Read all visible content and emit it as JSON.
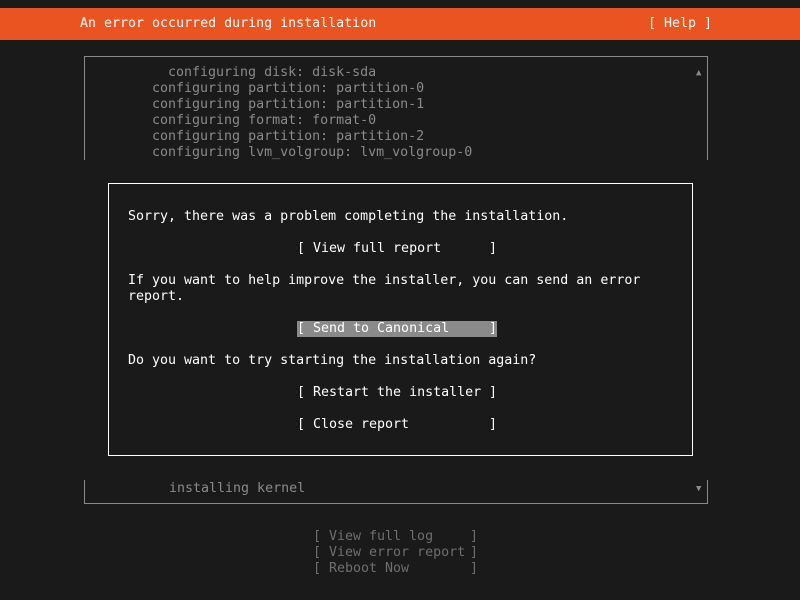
{
  "header": {
    "title": "An error occurred during installation",
    "help_label": "[ Help ]"
  },
  "log": {
    "lines": [
      "configuring disk: disk-sda",
      "configuring partition: partition-0",
      "configuring partition: partition-1",
      "configuring format: format-0",
      "configuring partition: partition-2",
      "configuring lvm_volgroup: lvm_volgroup-0"
    ],
    "scroll_up_glyph": "▲",
    "scroll_down_glyph": "▼",
    "status_line": "installing kernel"
  },
  "dialog": {
    "message1": "Sorry, there was a problem completing the installation.",
    "message2": "If you want to help improve the installer, you can send an error\nreport.",
    "message3": "Do you want to try starting the installation again?",
    "bracket_left": "[",
    "bracket_right": "]",
    "view_full_report": "View full report",
    "send_to_canonical": "Send to Canonical",
    "restart_installer": "Restart the installer",
    "close_report": "Close report"
  },
  "bottom": {
    "bracket_left": "[",
    "bracket_right": "]",
    "view_full_log": "View full log",
    "view_error_report": "View error report",
    "reboot_now": "Reboot Now"
  },
  "colors": {
    "accent": "#e95420",
    "background": "#1a1a1a",
    "text": "#ffffff",
    "muted": "#8a8a8a",
    "disabled": "#6e6e6e"
  }
}
